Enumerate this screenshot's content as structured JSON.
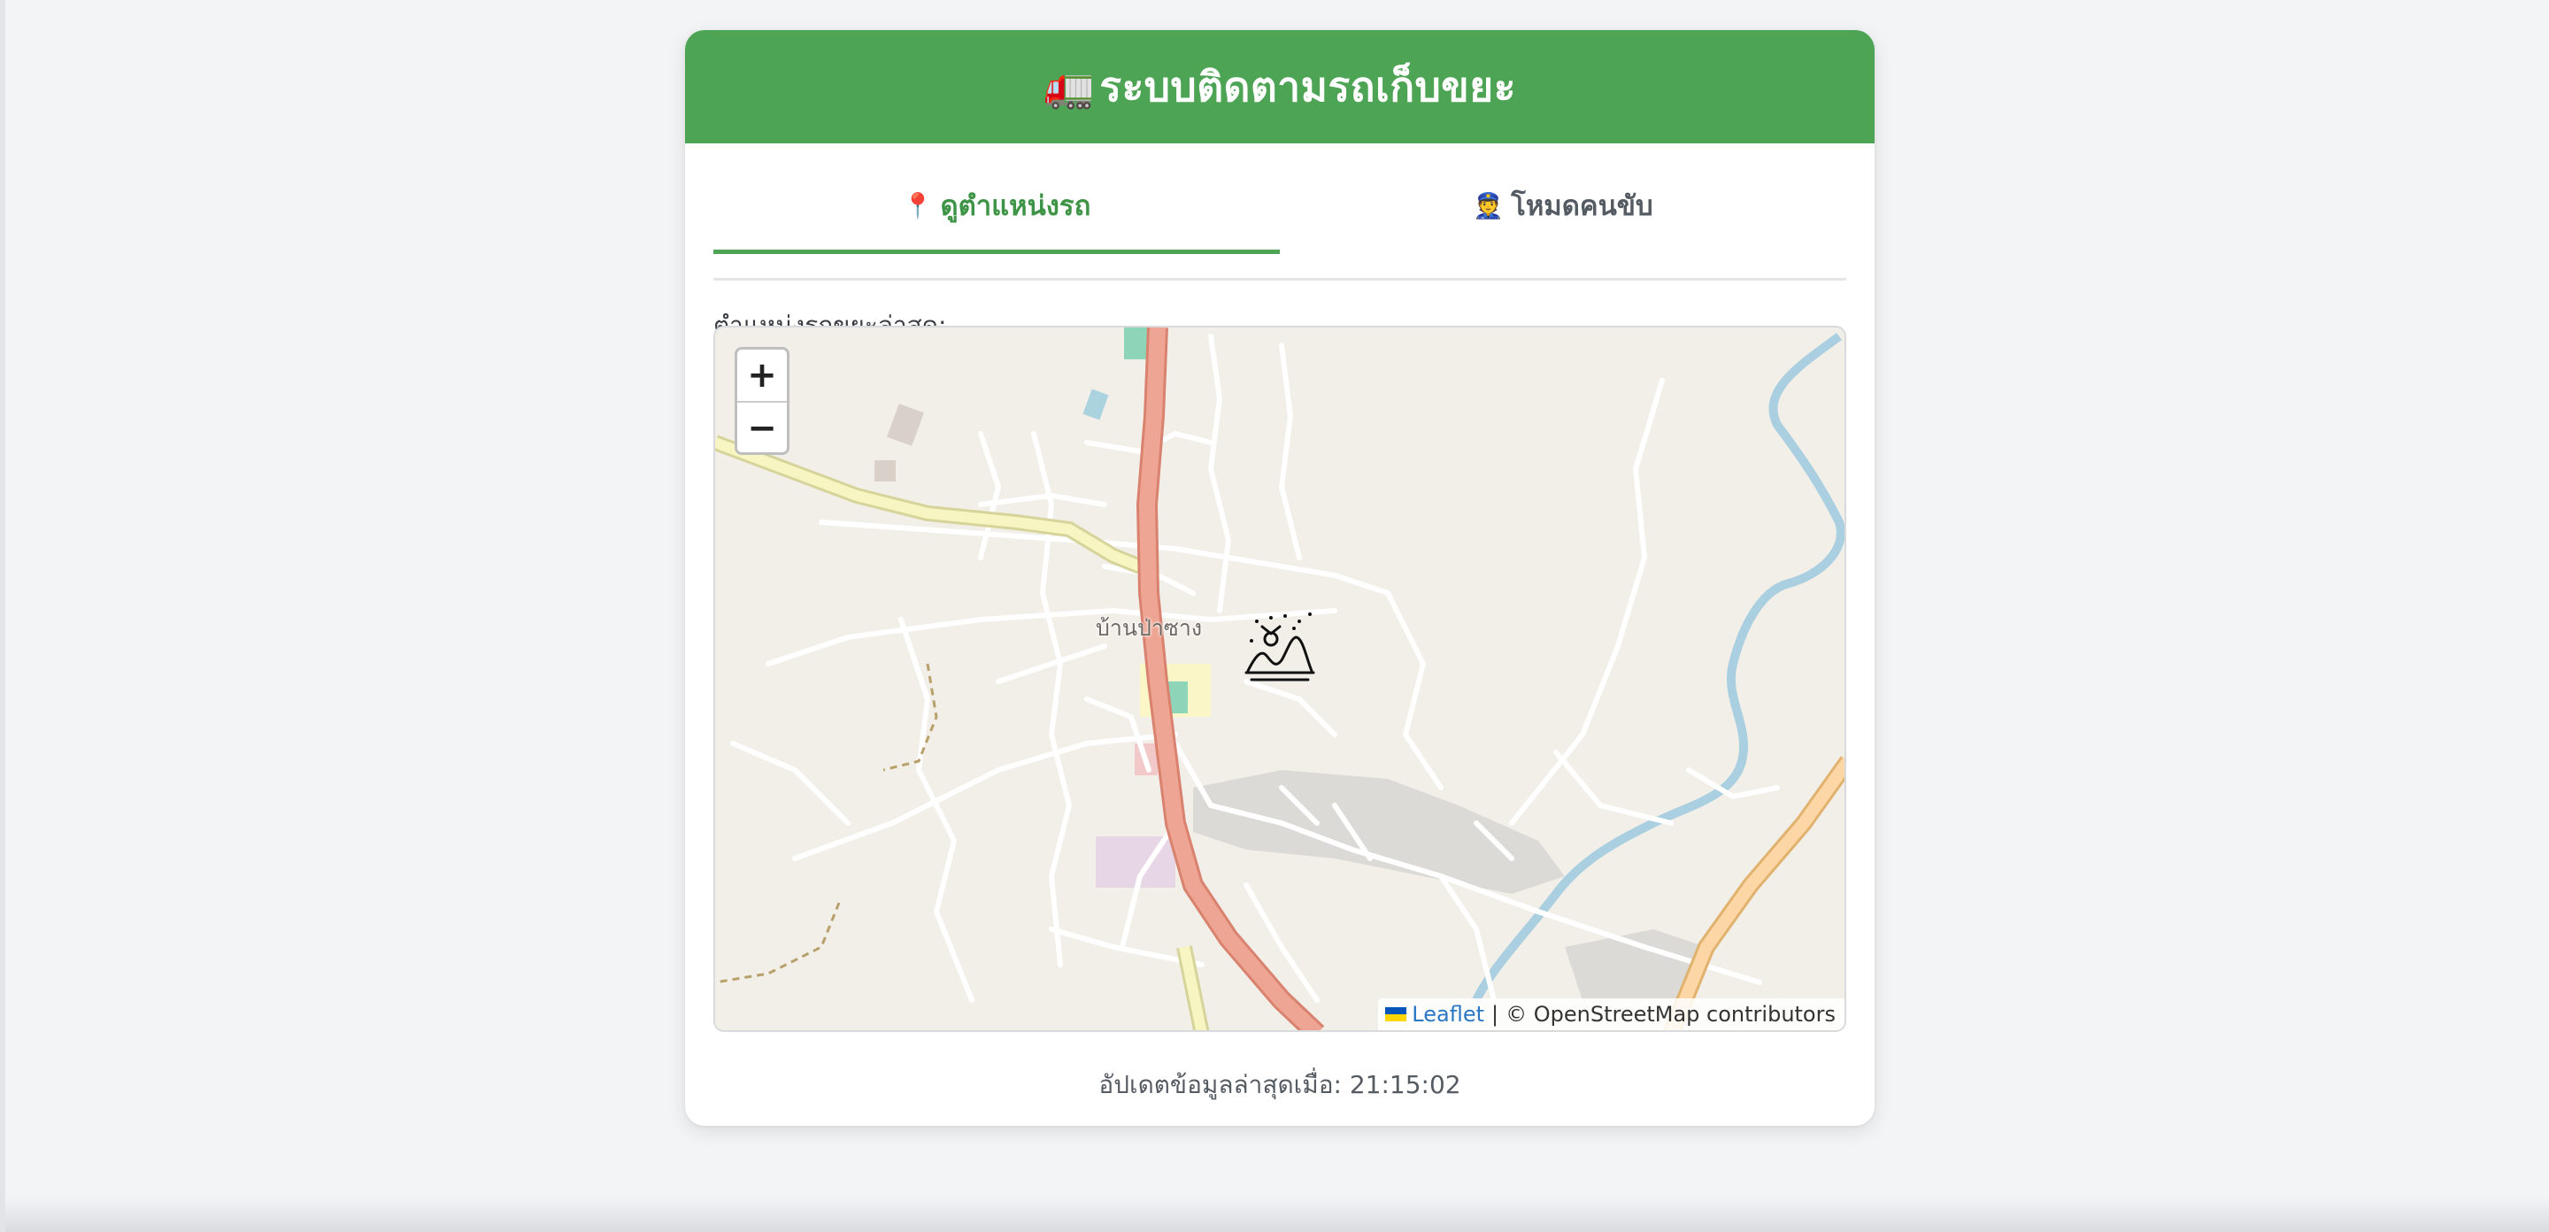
{
  "header": {
    "truck_icon": "🚛",
    "title": "ระบบติดตามรถเก็บขยะ",
    "background_color": "#4ca454"
  },
  "tabs": [
    {
      "icon": "📍",
      "icon_name": "pin-icon",
      "label": "ดูตำแหน่งรถ",
      "active": true
    },
    {
      "icon": "👮",
      "icon_name": "driver-icon",
      "label": "โหมดคนขับ",
      "active": false
    }
  ],
  "map_section": {
    "label": "ตำแหน่งรถขยะล่าสุด:",
    "place_label": "บ้านป่าซาง",
    "zoom_in": "+",
    "zoom_out": "−",
    "attribution": {
      "leaflet": "Leaflet",
      "separator": "|",
      "osm": "© OpenStreetMap contributors"
    }
  },
  "footer": {
    "updated_text": "อัปเดตข้อมูลล่าสุดเมื่อ: 21:15:02"
  }
}
